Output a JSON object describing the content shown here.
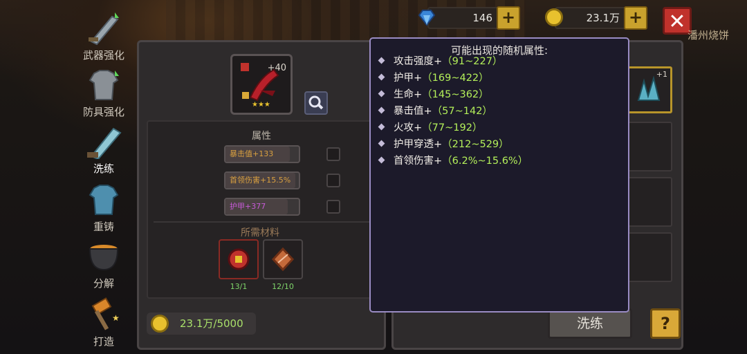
{
  "top_bar": {
    "gems": "146",
    "coins": "23.1万",
    "city_label": "潘州烧饼"
  },
  "sidebar": {
    "items": [
      {
        "label": "武器强化",
        "active": false
      },
      {
        "label": "防具强化",
        "active": false
      },
      {
        "label": "洗练",
        "active": true
      },
      {
        "label": "重铸",
        "active": false
      },
      {
        "label": "分解",
        "active": false
      },
      {
        "label": "打造",
        "active": false
      }
    ]
  },
  "item": {
    "level": "+40",
    "stars": "★★★"
  },
  "right_item": {
    "level": "+1"
  },
  "attributes": {
    "title": "属性",
    "rows": [
      {
        "text": "暴击值+133",
        "color": "#d9a040",
        "fill": 0.88
      },
      {
        "text": "首领伤害+15.5%",
        "color": "#d9a040",
        "fill": 0.95
      },
      {
        "text": "护甲+377",
        "color": "#c75ad8",
        "fill": 0.85
      }
    ]
  },
  "materials": {
    "title": "所需材料",
    "items": [
      {
        "count": "13/1",
        "count_color": "#7fd66b"
      },
      {
        "count": "12/10",
        "count_color": "#7fd66b"
      }
    ]
  },
  "gold": {
    "text": "23.1万/5000"
  },
  "buttons": {
    "wash": "洗练",
    "help": "?"
  },
  "tooltip": {
    "title": "可能出现的随机属性:",
    "rows": [
      {
        "name": "攻击强度+",
        "range": "（91~227）"
      },
      {
        "name": "护甲+",
        "range": "（169~422）"
      },
      {
        "name": "生命+",
        "range": "（145~362）"
      },
      {
        "name": "暴击值+",
        "range": "（57~142）"
      },
      {
        "name": "火攻+",
        "range": "（77~192）"
      },
      {
        "name": "护甲穿透+",
        "range": "（212~529）"
      },
      {
        "name": "首领伤害+",
        "range": "（6.2%~15.6%）"
      }
    ]
  },
  "colors": {
    "accent_green": "#b4f05a",
    "tooltip_border": "#9a8cc4",
    "close_red": "#c0322c",
    "gold_button": "#d9a838"
  }
}
